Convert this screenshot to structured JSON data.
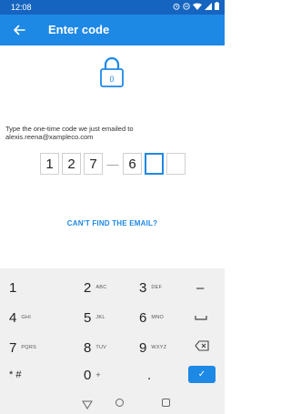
{
  "status_bar": {
    "time": "12:08",
    "icons": [
      "alarm-icon",
      "minus-circle-icon",
      "wifi-icon",
      "signal-icon",
      "battery-icon"
    ]
  },
  "app_bar": {
    "title": "Enter code",
    "back_icon": "arrow-left-icon"
  },
  "lock_digit": "0",
  "instruction": "Type the one-time code we just emailed to alexis.reena@xampleco.com",
  "code": {
    "digits": [
      "1",
      "2",
      "7",
      "6",
      "",
      ""
    ],
    "separator": "—"
  },
  "link": {
    "cant_find": "CAN'T FIND THE EMAIL?"
  },
  "keyboard": {
    "rows": [
      [
        {
          "main": "1",
          "sub": ""
        },
        {
          "main": "2",
          "sub": "ABC"
        },
        {
          "main": "3",
          "sub": "DEF"
        },
        {
          "main": "–",
          "sub": ""
        }
      ],
      [
        {
          "main": "4",
          "sub": "GHI"
        },
        {
          "main": "5",
          "sub": "JKL"
        },
        {
          "main": "6",
          "sub": "MNO"
        },
        {
          "main": "␣",
          "sub": ""
        }
      ],
      [
        {
          "main": "7",
          "sub": "PQRS"
        },
        {
          "main": "8",
          "sub": "TUV"
        },
        {
          "main": "9",
          "sub": "WXYZ"
        },
        {
          "main": "⌫",
          "sub": ""
        }
      ],
      [
        {
          "main": "* #",
          "sub": ""
        },
        {
          "main": "0",
          "sub": "+"
        },
        {
          "main": ".",
          "sub": ""
        },
        {
          "main": "✓",
          "sub": ""
        }
      ]
    ]
  },
  "colors": {
    "status_bar": "#1565c0",
    "app_bar": "#1e88e5",
    "accent": "#1e88e5",
    "keyboard_bg": "#f0f0f0"
  }
}
